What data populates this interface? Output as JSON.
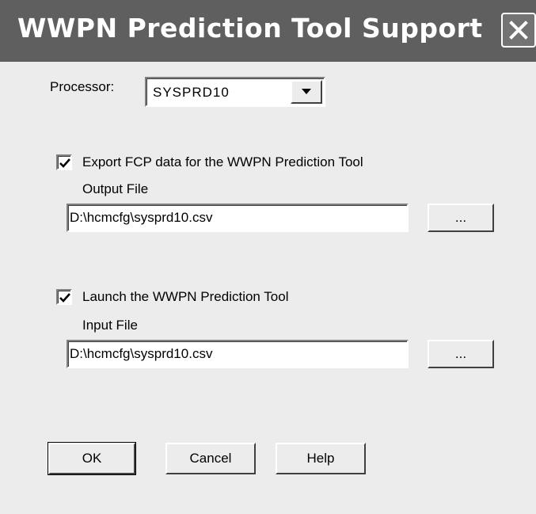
{
  "window": {
    "title": "WWPN Prediction Tool Support",
    "close_icon": "close-icon"
  },
  "processor": {
    "label": "Processor:",
    "selected": "SYSPRD10",
    "dropdown_icon": "chevron-down-icon"
  },
  "export": {
    "checked": true,
    "label": "Export FCP data for the WWPN Prediction Tool",
    "file_label": "Output File",
    "file_value": "D:\\hcmcfg\\sysprd10.csv",
    "browse_label": "..."
  },
  "launch": {
    "checked": true,
    "label": "Launch the WWPN Prediction Tool",
    "file_label": "Input File",
    "file_value": "D:\\hcmcfg\\sysprd10.csv",
    "browse_label": "..."
  },
  "buttons": {
    "ok": "OK",
    "cancel": "Cancel",
    "help": "Help"
  },
  "colors": {
    "titlebar": "#5f5f5f",
    "dialog_bg": "#ececec"
  }
}
